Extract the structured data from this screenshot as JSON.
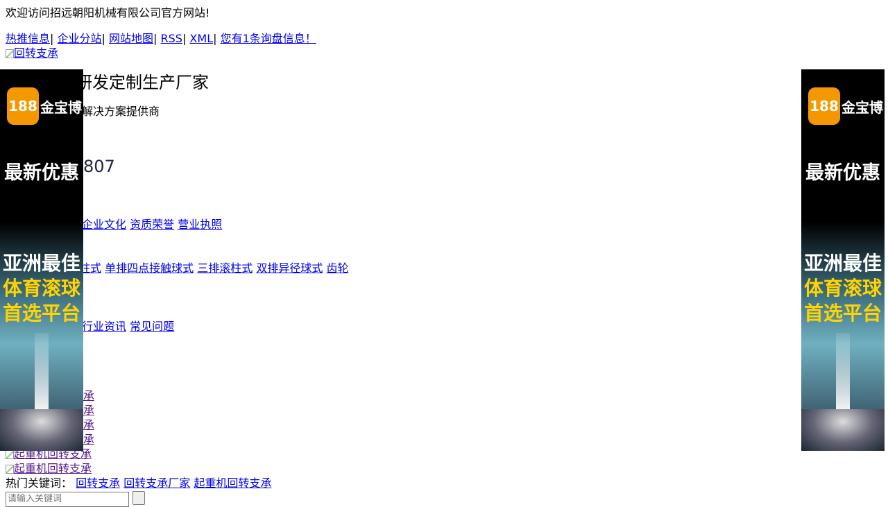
{
  "header": {
    "welcome": "欢迎访问招远朝阳机械有限公司官方网站!",
    "links": [
      "热推信息",
      "企业分站",
      "网站地图",
      "RSS",
      "XML",
      "您有1条询盘信息！"
    ],
    "logo_alt": "回转支承"
  },
  "hero": {
    "headline_fragment": "研发定制生产厂家",
    "subline_fragment": "解决方案提供商",
    "phone_fragment": "807"
  },
  "nav": {
    "about_links": [
      "企业文化",
      "资质荣誉",
      "营业执照"
    ],
    "product_links": [
      "滚柱式",
      "单排四点接触球式",
      "三排滚柱式",
      "双排异径球式",
      "齿轮"
    ],
    "news_links": [
      "行业资讯",
      "常见问题"
    ]
  },
  "cases": {
    "partial_labels": [
      "承",
      "承",
      "承",
      "承"
    ],
    "image_alts": [
      "起重机回转支承",
      "起重机回转支承"
    ]
  },
  "hot_keywords": {
    "label": "热门关键词：",
    "items": [
      "回转支承",
      "回转支承厂家",
      "起重机回转支承"
    ]
  },
  "search": {
    "placeholder": "请输入关键词",
    "button_label": ""
  },
  "ad": {
    "logo_number": "188",
    "brand": "金宝博",
    "promo": "最新优惠",
    "slogan": [
      "亚洲最佳",
      "体育滚球",
      "首选平台"
    ]
  },
  "colors": {
    "link": "#0000ee",
    "visited_link": "#551a8b",
    "ad_logo": "#f39800",
    "ad_slogan_yellow": "#ffd400"
  }
}
